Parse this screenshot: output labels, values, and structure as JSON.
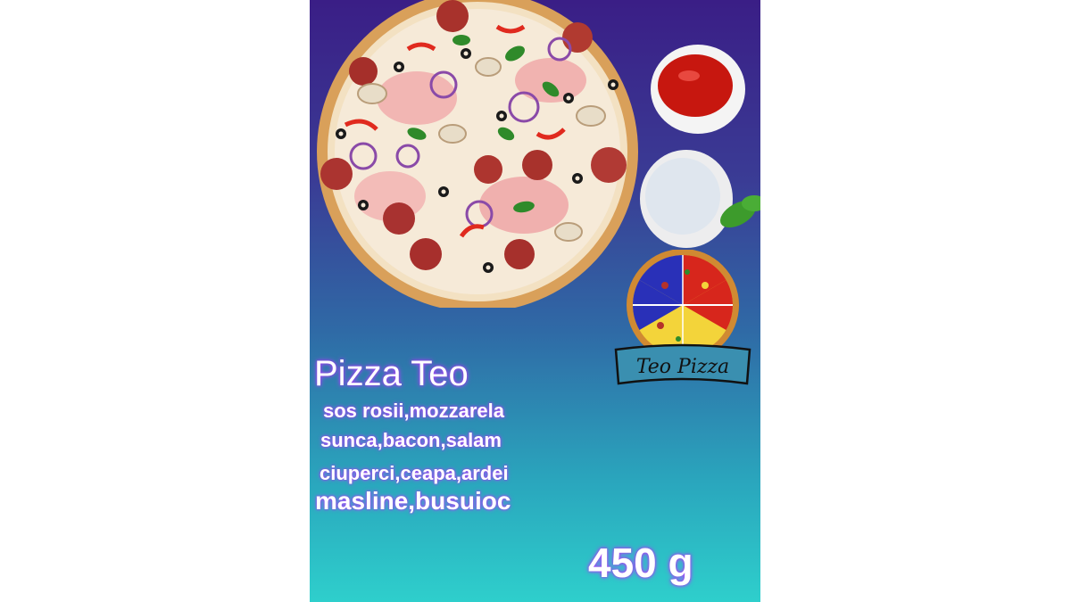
{
  "poster": {
    "title": "Pizza Teo",
    "ingredients": [
      "sos rosii,mozzarela",
      "sunca,bacon,salam",
      "ciuperci,ceapa,ardei",
      "masline,busuioc"
    ],
    "weight": "450 g"
  },
  "logo": {
    "text": "Teo Pizza"
  },
  "colors": {
    "gradient_top": "#3a1e86",
    "gradient_bottom": "#2ecfcc",
    "text_glow": "#b44bff"
  }
}
